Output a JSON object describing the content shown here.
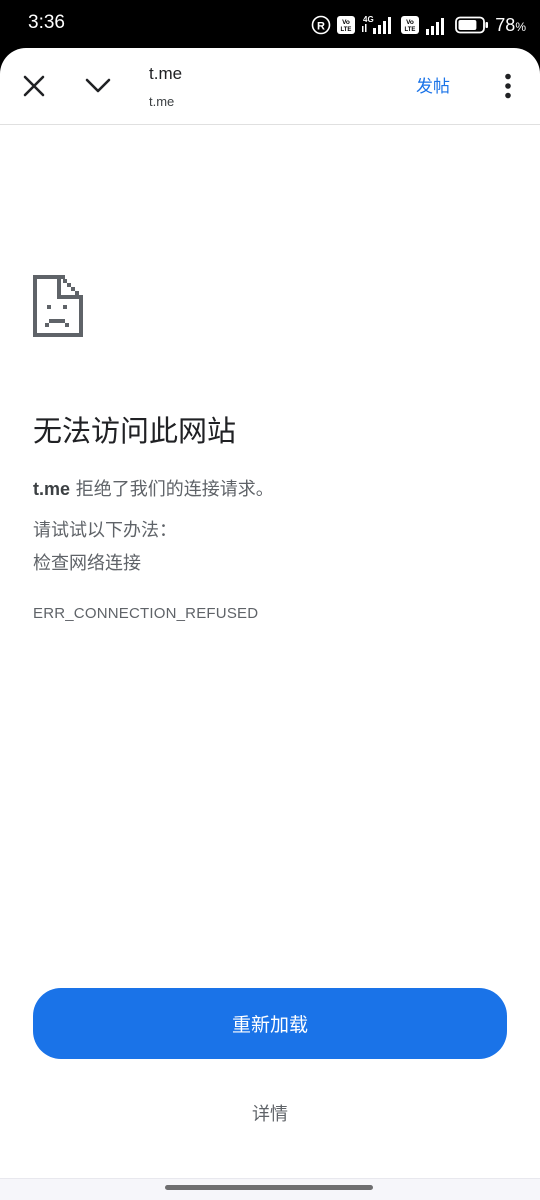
{
  "status_bar": {
    "time": "3:36",
    "battery_percent": "78",
    "battery_suffix": "%",
    "network": "4G",
    "volte_label": "Vo\nLTE",
    "registered_icon": "registered-trademark-icon",
    "battery_level": 0.78
  },
  "toolbar": {
    "title": "t.me",
    "subtitle": "t.me",
    "post_label": "发帖",
    "icons": [
      "close-icon",
      "chevron-down-icon",
      "more-vert-icon"
    ]
  },
  "error": {
    "icon": "sad-page-icon",
    "title": "无法访问此网站",
    "host": "t.me",
    "message": "拒绝了我们的连接请求。",
    "try_heading": "请试试以下办法：",
    "suggestion": "检查网络连接",
    "code": "ERR_CONNECTION_REFUSED"
  },
  "actions": {
    "reload_label": "重新加载",
    "details_label": "详情"
  },
  "colors": {
    "accent": "#1a73e8",
    "text_primary": "#202124",
    "text_secondary": "#5f6368"
  }
}
